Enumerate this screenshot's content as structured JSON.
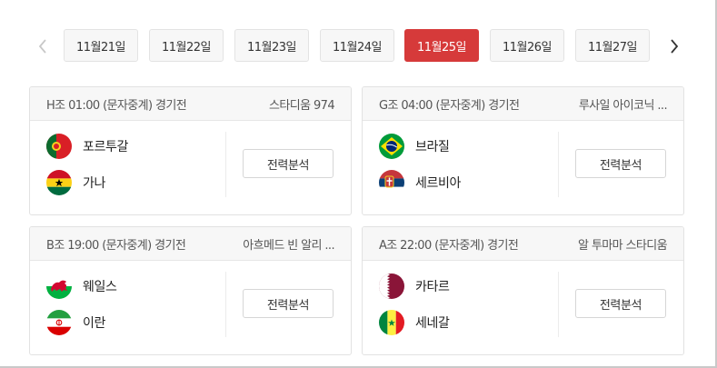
{
  "dates": {
    "tabs": [
      "11월21일",
      "11월22일",
      "11월23일",
      "11월24일",
      "11월25일",
      "11월26일",
      "11월27일"
    ],
    "active_index": 4,
    "prev_icon": "chevron-left-icon",
    "next_icon": "chevron-right-icon"
  },
  "colors": {
    "accent": "#d63a3a",
    "tab_bg": "#f7f7f7"
  },
  "matches": [
    {
      "header": "H조 01:00 (문자중계) 경기전",
      "venue": "스타디움 974",
      "team1": {
        "name": "포르투갈",
        "flag": "portugal-flag-icon"
      },
      "team2": {
        "name": "가나",
        "flag": "ghana-flag-icon"
      },
      "button": "전력분석"
    },
    {
      "header": "G조 04:00 (문자중계) 경기전",
      "venue": "루사일 아이코닉 ...",
      "team1": {
        "name": "브라질",
        "flag": "brazil-flag-icon"
      },
      "team2": {
        "name": "세르비아",
        "flag": "serbia-flag-icon"
      },
      "button": "전력분석"
    },
    {
      "header": "B조 19:00 (문자중계) 경기전",
      "venue": "아흐메드 빈 알리 ...",
      "team1": {
        "name": "웨일스",
        "flag": "wales-flag-icon"
      },
      "team2": {
        "name": "이란",
        "flag": "iran-flag-icon"
      },
      "button": "전력분석"
    },
    {
      "header": "A조 22:00 (문자중계) 경기전",
      "venue": "알 투마마 스타디움",
      "team1": {
        "name": "카타르",
        "flag": "qatar-flag-icon"
      },
      "team2": {
        "name": "세네갈",
        "flag": "senegal-flag-icon"
      },
      "button": "전력분석"
    }
  ]
}
